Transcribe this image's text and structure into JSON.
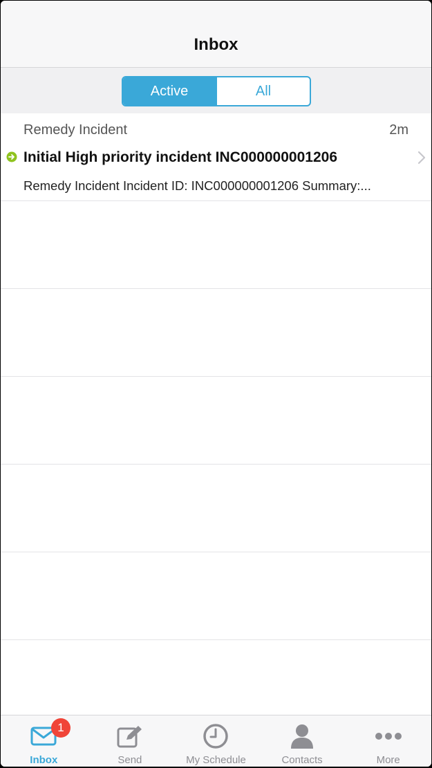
{
  "header": {
    "title": "Inbox"
  },
  "filter": {
    "segments": [
      "Active",
      "All"
    ],
    "selected": "Active"
  },
  "inbox": {
    "items": [
      {
        "sender": "Remedy Incident",
        "time": "2m",
        "subject": "Initial High priority incident INC000000001206",
        "preview": "Remedy Incident Incident ID: INC000000001206 Summary:..."
      }
    ]
  },
  "tab_bar": {
    "selected": "Inbox",
    "tabs": [
      {
        "label": "Inbox",
        "icon": "envelope-icon",
        "badge": "1"
      },
      {
        "label": "Send",
        "icon": "compose-icon"
      },
      {
        "label": "My Schedule",
        "icon": "clock-icon"
      },
      {
        "label": "Contacts",
        "icon": "person-icon"
      },
      {
        "label": "More",
        "icon": "ellipsis-icon"
      }
    ]
  },
  "colors": {
    "accent": "#3aa8d8",
    "badge": "#f04438",
    "status_indicator": "#8fc31f",
    "inactive_tab": "#8e8e93"
  }
}
